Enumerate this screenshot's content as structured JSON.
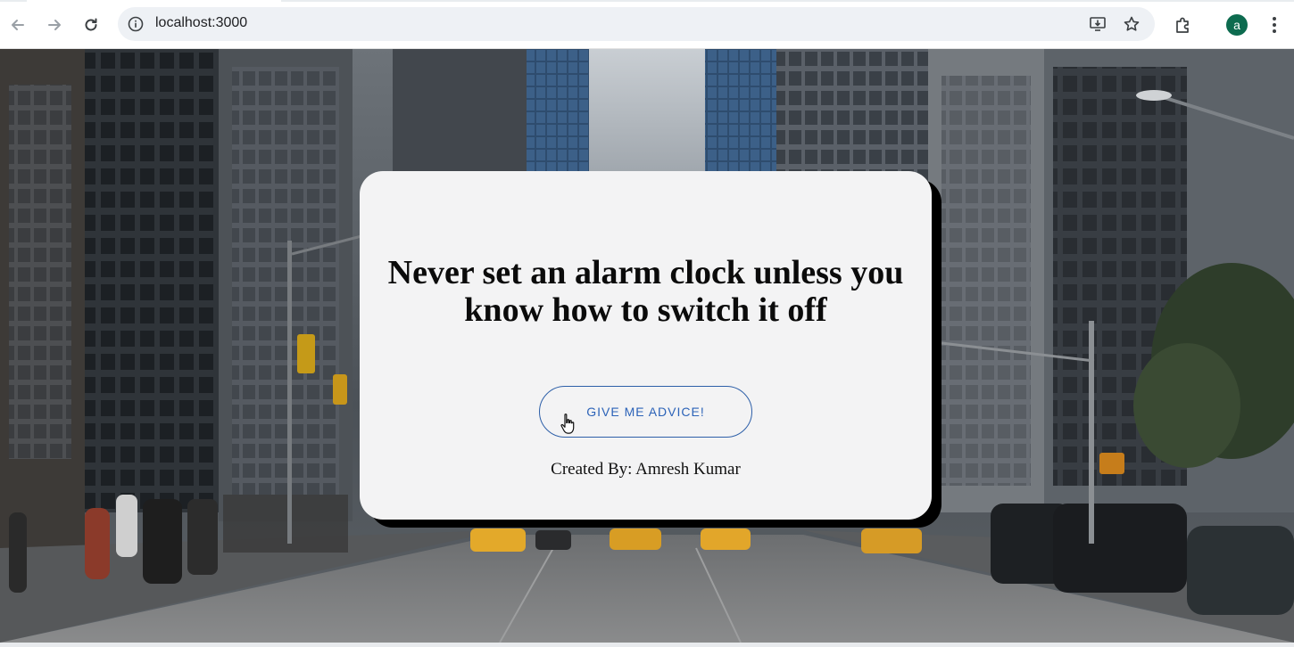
{
  "browser": {
    "url": "localhost:3000",
    "profile_initial": "a",
    "icons": {
      "back": "arrow-left-icon",
      "forward": "arrow-right-icon",
      "reload": "reload-icon",
      "site_info": "info-icon",
      "install": "install-app-icon",
      "bookmark": "star-icon",
      "extensions": "puzzle-icon",
      "menu": "kebab-menu-icon"
    },
    "colors": {
      "avatar": "#0d6b4f",
      "omnibox": "#eef1f5"
    }
  },
  "page": {
    "advice": "Never set an alarm clock unless you know how to switch it off",
    "button_label": "GIVE ME ADVICE!",
    "credit": "Created By: Amresh Kumar",
    "colors": {
      "card": "#f3f3f4",
      "button_text": "#2c63b8",
      "shadow": "#000000"
    }
  }
}
